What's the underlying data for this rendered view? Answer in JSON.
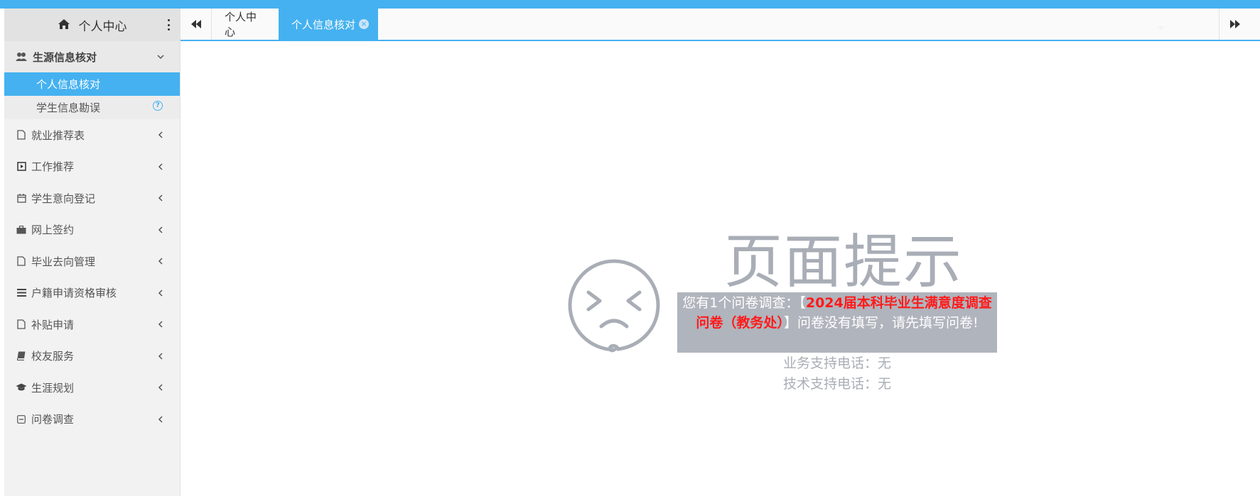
{
  "sidebar": {
    "title": "个人中心",
    "group": {
      "label": "生源信息核对",
      "items": [
        {
          "label": "个人信息核对",
          "active": true
        },
        {
          "label": "学生信息勘误",
          "active": false
        }
      ]
    },
    "menu": [
      {
        "label": "就业推荐表",
        "icon": "file-icon"
      },
      {
        "label": "工作推荐",
        "icon": "play-square-icon"
      },
      {
        "label": "学生意向登记",
        "icon": "calendar-icon"
      },
      {
        "label": "网上签约",
        "icon": "briefcase-icon"
      },
      {
        "label": "毕业去向管理",
        "icon": "file-icon"
      },
      {
        "label": "户籍申请资格审核",
        "icon": "list-icon"
      },
      {
        "label": "补贴申请",
        "icon": "file-icon"
      },
      {
        "label": "校友服务",
        "icon": "book-icon"
      },
      {
        "label": "生涯规划",
        "icon": "graduation-cap-icon"
      },
      {
        "label": "问卷调查",
        "icon": "minus-square-icon"
      }
    ]
  },
  "tabs": {
    "home": "个人中心",
    "active": "个人信息核对",
    "close_glyph": "×"
  },
  "notice": {
    "title": "页面提示",
    "prefix": "您有1个问卷调查：【",
    "survey_name": "2024届本科毕业生满意度调查问卷（教务处）",
    "suffix": "】问卷没有填写，请先填写问卷!",
    "business_support": "业务支持电话：无",
    "tech_support": "技术支持电话：无"
  },
  "colors": {
    "accent": "#45b1f0",
    "sidebar_bg": "#f2f2f2",
    "notice_box": "#b0b4bd",
    "highlight": "#ff1a1a",
    "muted_text": "#a9adb6"
  }
}
